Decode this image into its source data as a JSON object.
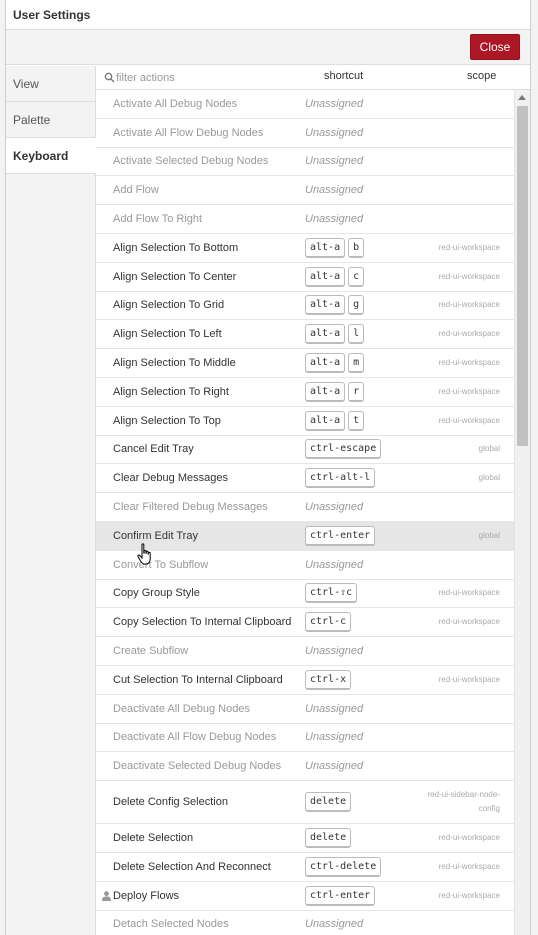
{
  "dialog": {
    "title": "User Settings",
    "close_label": "Close"
  },
  "tabs": [
    {
      "label": "View"
    },
    {
      "label": "Palette"
    },
    {
      "label": "Keyboard"
    }
  ],
  "filter": {
    "placeholder": "filter actions",
    "col_shortcut": "shortcut",
    "col_scope": "scope"
  },
  "rows": [
    {
      "action": "Activate All Debug Nodes",
      "keys": [],
      "scope": "",
      "unassigned": "Unassigned"
    },
    {
      "action": "Activate All Flow Debug Nodes",
      "keys": [],
      "scope": "",
      "unassigned": "Unassigned"
    },
    {
      "action": "Activate Selected Debug Nodes",
      "keys": [],
      "scope": "",
      "unassigned": "Unassigned"
    },
    {
      "action": "Add Flow",
      "keys": [],
      "scope": "",
      "unassigned": "Unassigned"
    },
    {
      "action": "Add Flow To Right",
      "keys": [],
      "scope": "",
      "unassigned": "Unassigned"
    },
    {
      "action": "Align Selection To Bottom",
      "keys": [
        "alt-a",
        "b"
      ],
      "scope": "red-ui-workspace"
    },
    {
      "action": "Align Selection To Center",
      "keys": [
        "alt-a",
        "c"
      ],
      "scope": "red-ui-workspace"
    },
    {
      "action": "Align Selection To Grid",
      "keys": [
        "alt-a",
        "g"
      ],
      "scope": "red-ui-workspace"
    },
    {
      "action": "Align Selection To Left",
      "keys": [
        "alt-a",
        "l"
      ],
      "scope": "red-ui-workspace"
    },
    {
      "action": "Align Selection To Middle",
      "keys": [
        "alt-a",
        "m"
      ],
      "scope": "red-ui-workspace"
    },
    {
      "action": "Align Selection To Right",
      "keys": [
        "alt-a",
        "r"
      ],
      "scope": "red-ui-workspace"
    },
    {
      "action": "Align Selection To Top",
      "keys": [
        "alt-a",
        "t"
      ],
      "scope": "red-ui-workspace"
    },
    {
      "action": "Cancel Edit Tray",
      "keys": [
        "ctrl-escape"
      ],
      "scope": "global"
    },
    {
      "action": "Clear Debug Messages",
      "keys": [
        "ctrl-alt-l"
      ],
      "scope": "global"
    },
    {
      "action": "Clear Filtered Debug Messages",
      "keys": [],
      "scope": "",
      "unassigned": "Unassigned"
    },
    {
      "action": "Confirm Edit Tray",
      "keys": [
        "ctrl-enter"
      ],
      "scope": "global",
      "hover": true
    },
    {
      "action": "Convert To Subflow",
      "keys": [],
      "scope": "",
      "unassigned": "Unassigned"
    },
    {
      "action": "Copy Group Style",
      "keys": [
        "ctrl-⇧c"
      ],
      "scope": "red-ui-workspace"
    },
    {
      "action": "Copy Selection To Internal Clipboard",
      "keys": [
        "ctrl-c"
      ],
      "scope": "red-ui-workspace"
    },
    {
      "action": "Create Subflow",
      "keys": [],
      "scope": "",
      "unassigned": "Unassigned"
    },
    {
      "action": "Cut Selection To Internal Clipboard",
      "keys": [
        "ctrl-x"
      ],
      "scope": "red-ui-workspace"
    },
    {
      "action": "Deactivate All Debug Nodes",
      "keys": [],
      "scope": "",
      "unassigned": "Unassigned"
    },
    {
      "action": "Deactivate All Flow Debug Nodes",
      "keys": [],
      "scope": "",
      "unassigned": "Unassigned"
    },
    {
      "action": "Deactivate Selected Debug Nodes",
      "keys": [],
      "scope": "",
      "unassigned": "Unassigned"
    },
    {
      "action": "Delete Config Selection",
      "keys": [
        "delete"
      ],
      "scope": "red-ui-sidebar-node-config",
      "tall": true
    },
    {
      "action": "Delete Selection",
      "keys": [
        "delete"
      ],
      "scope": "red-ui-workspace"
    },
    {
      "action": "Delete Selection And Reconnect",
      "keys": [
        "ctrl-delete"
      ],
      "scope": "red-ui-workspace"
    },
    {
      "action": "Deploy Flows",
      "keys": [
        "ctrl-enter"
      ],
      "scope": "red-ui-workspace",
      "user_icon": true
    },
    {
      "action": "Detach Selected Nodes",
      "keys": [],
      "scope": "",
      "unassigned": "Unassigned"
    }
  ]
}
